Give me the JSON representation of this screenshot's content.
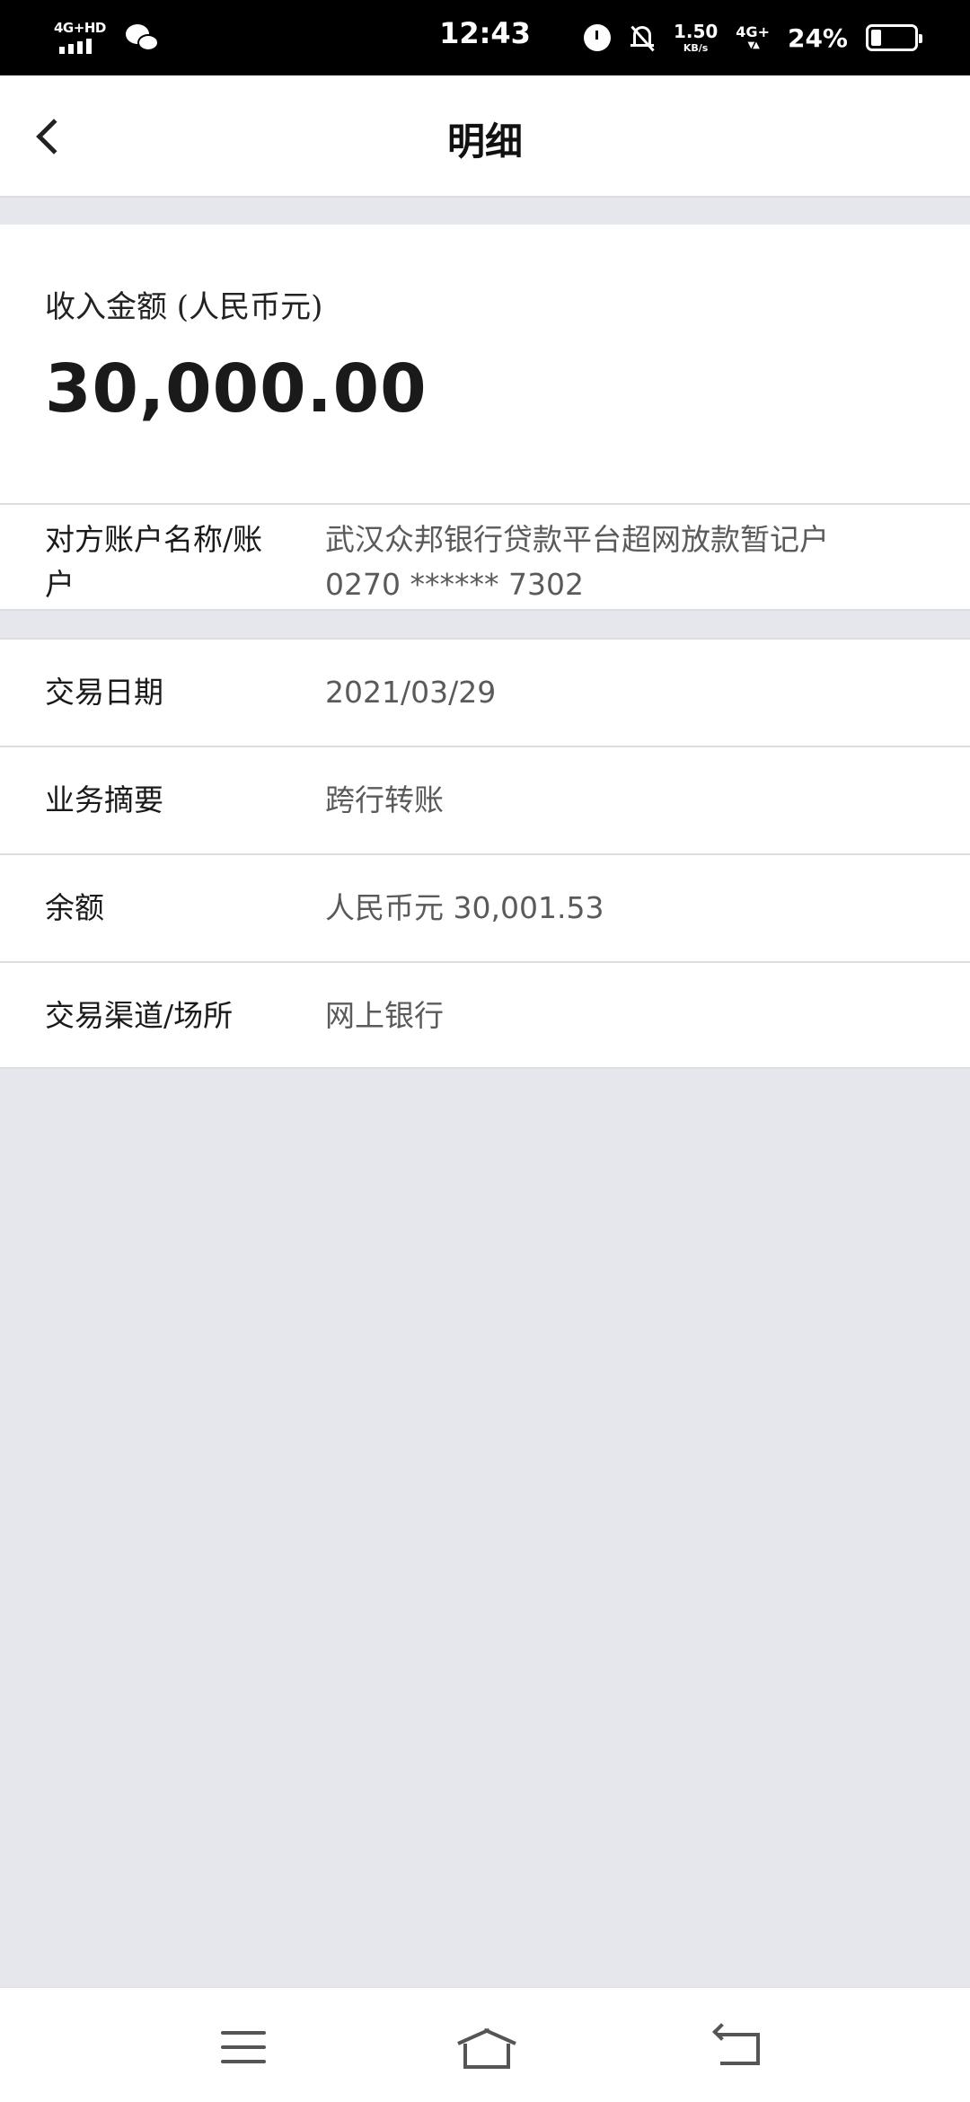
{
  "status_bar": {
    "network_label": "4G+HD",
    "time": "12:43",
    "speed_value": "1.50",
    "speed_unit": "KB/s",
    "mobile_data": "4G+",
    "battery_percent": "24%",
    "battery_level": 0.24
  },
  "header": {
    "title": "明细"
  },
  "amount": {
    "label": "收入金额 (人民币元)",
    "value": "30,000.00"
  },
  "account": {
    "label": "对方账户名称/账户",
    "name": "武汉众邦银行贷款平台超网放款暂记户",
    "number": "0270 ****** 7302"
  },
  "details": {
    "date_label": "交易日期",
    "date_value": "2021/03/29",
    "summary_label": "业务摘要",
    "summary_value": "跨行转账",
    "balance_label": "余额",
    "balance_currency": "人民币元",
    "balance_value": "30,001.53",
    "channel_label": "交易渠道/场所",
    "channel_value": "网上银行"
  },
  "colors": {
    "status_bar_bg": "#000000",
    "page_bg": "#e6e7ec",
    "card_bg": "#ffffff",
    "value_text": "#5a5a5a"
  }
}
